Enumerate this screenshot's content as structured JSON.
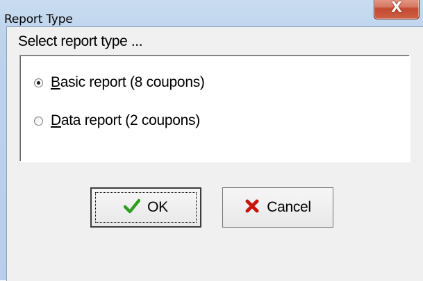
{
  "window": {
    "title": "Report Type",
    "close_glyph": "X"
  },
  "dialog": {
    "prompt": "Select report type ..."
  },
  "options": [
    {
      "mnemonic": "B",
      "label_rest": "asic report (8 coupons)",
      "selected": true
    },
    {
      "mnemonic": "D",
      "label_rest": "ata report (2 coupons)",
      "selected": false
    }
  ],
  "buttons": {
    "ok": {
      "label": "OK",
      "icon": "check-icon",
      "icon_color": "#2e9e20"
    },
    "cancel": {
      "label": "Cancel",
      "icon": "cross-icon",
      "icon_color": "#c8150c"
    }
  }
}
